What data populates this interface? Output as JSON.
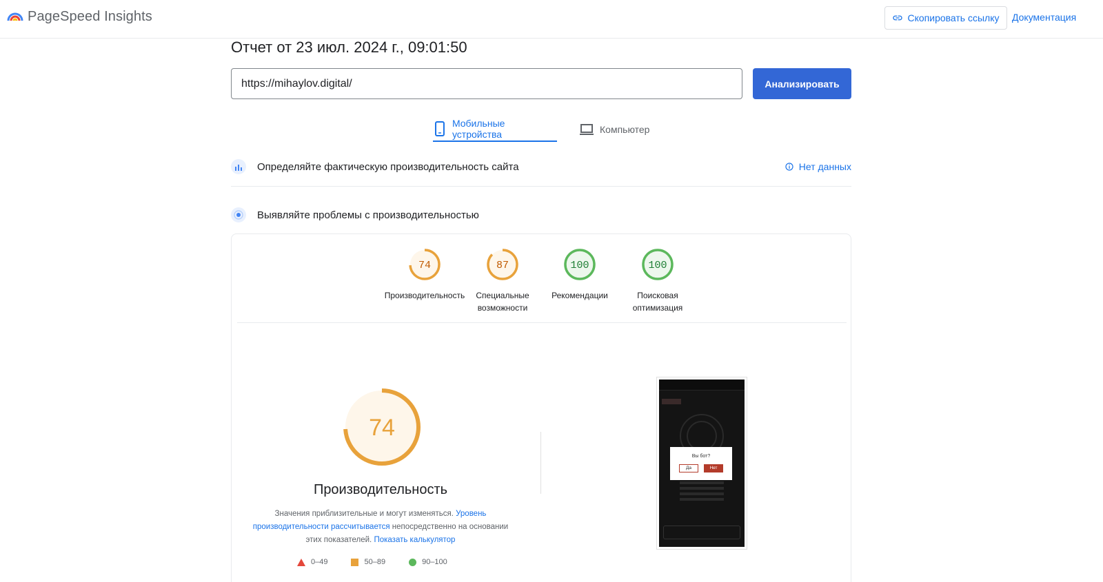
{
  "app": {
    "name": "PageSpeed Insights",
    "copy_link_label": "Скопировать ссылку",
    "docs_label": "Документация"
  },
  "report": {
    "title": "Отчет от 23 июл. 2024 г., 09:01:50",
    "url_value": "https://mihaylov.digital/",
    "analyze_label": "Анализировать"
  },
  "tabs": [
    {
      "label": "Мобильные устройства",
      "active": true
    },
    {
      "label": "Компьютер",
      "active": false
    }
  ],
  "field_data": {
    "label": "Определяйте фактическую производительность сайта",
    "status": "Нет данных"
  },
  "lab_data": {
    "label": "Выявляйте проблемы с производительностью"
  },
  "scores": [
    {
      "value": "74",
      "label_line1": "Производительность",
      "label_line2": "",
      "color": "#e8a23b",
      "fraction": 0.74
    },
    {
      "value": "87",
      "label_line1": "Специальные",
      "label_line2": "возможности",
      "color": "#e8a23b",
      "fraction": 0.87
    },
    {
      "value": "100",
      "label_line1": "Рекомендации",
      "label_line2": "",
      "color": "#5cb85c",
      "fraction": 1.0
    },
    {
      "value": "100",
      "label_line1": "Поисковая",
      "label_line2": "оптимизация",
      "color": "#5cb85c",
      "fraction": 1.0
    }
  ],
  "performance": {
    "score": "74",
    "fraction": 0.74,
    "title": "Производительность",
    "explain_part1": "Значения приблизительные и могут изменяться. ",
    "explain_link1": "Уровень производительности рассчитывается",
    "explain_part2": " непосредственно на основании этих показателей. ",
    "explain_link2": "Показать калькулятор",
    "legend": [
      {
        "range": "0–49",
        "color": "#e4473b"
      },
      {
        "range": "50–89",
        "color": "#e8a23b"
      },
      {
        "range": "90–100",
        "color": "#5cb85c"
      }
    ]
  },
  "screenshot": {
    "dialog_question": "Вы бот?",
    "dialog_yes": "Да",
    "dialog_no": "Нет"
  },
  "colors": {
    "accent": "#1a73e8",
    "primary_button": "#3367d6",
    "average": "#e8a23b",
    "good": "#5cb85c",
    "poor": "#e4473b"
  }
}
